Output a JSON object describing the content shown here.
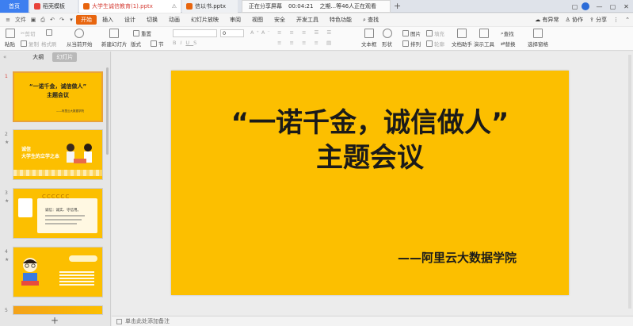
{
  "tabs": {
    "home": "首页",
    "template": "稻壳模板",
    "file1": "大学生诚信教育(1).pptx",
    "file2": "信以书.pptx",
    "share_label": "正在分享屏幕",
    "share_time": "00:04:21",
    "share_viewers": "之期...等46人正在观看"
  },
  "menu": {
    "file": "文件",
    "items": [
      "开始",
      "插入",
      "设计",
      "切换",
      "动画",
      "幻灯片放映",
      "审阅",
      "视图",
      "安全",
      "开发工具",
      "特色功能"
    ],
    "active": "开始",
    "search": "查找",
    "unsaved": "有异常",
    "collab": "协作",
    "share": "分享"
  },
  "ribbon": {
    "paste": "粘贴",
    "cut": "剪切",
    "copy": "复制",
    "format_painter": "格式刷",
    "from_start": "从当前开始",
    "new_slide": "新建幻灯片",
    "layout": "版式",
    "section": "节",
    "reset": "重置",
    "font_size": "0",
    "textbox": "文本框",
    "shape": "形状",
    "arrange": "排列",
    "picture": "图片",
    "fill": "填充",
    "outline": "轮廓",
    "doc_assistant": "文档助手",
    "present_tool": "演示工具",
    "find": "查找",
    "replace": "替换",
    "select_pane": "选择窗格"
  },
  "panel": {
    "outline_tab": "大纲",
    "slides_tab": "幻灯片"
  },
  "thumbs": [
    {
      "num": "1",
      "title": "“一诺千金，诚信做人”\n主题会议",
      "sub": "——阿里云大数据学院"
    },
    {
      "num": "2",
      "title": "诚信\n大学生的立学之本"
    },
    {
      "num": "3",
      "text": "诚信：诚实、守信用。"
    },
    {
      "num": "4"
    },
    {
      "num": "5"
    }
  ],
  "slide": {
    "title_line1": "“一诺千金，诚信做人”",
    "title_line2": "主题会议",
    "subtitle": "——阿里云大数据学院",
    "bg_color": "#fcbf00"
  },
  "notes": {
    "placeholder": "单击此处添加备注"
  }
}
